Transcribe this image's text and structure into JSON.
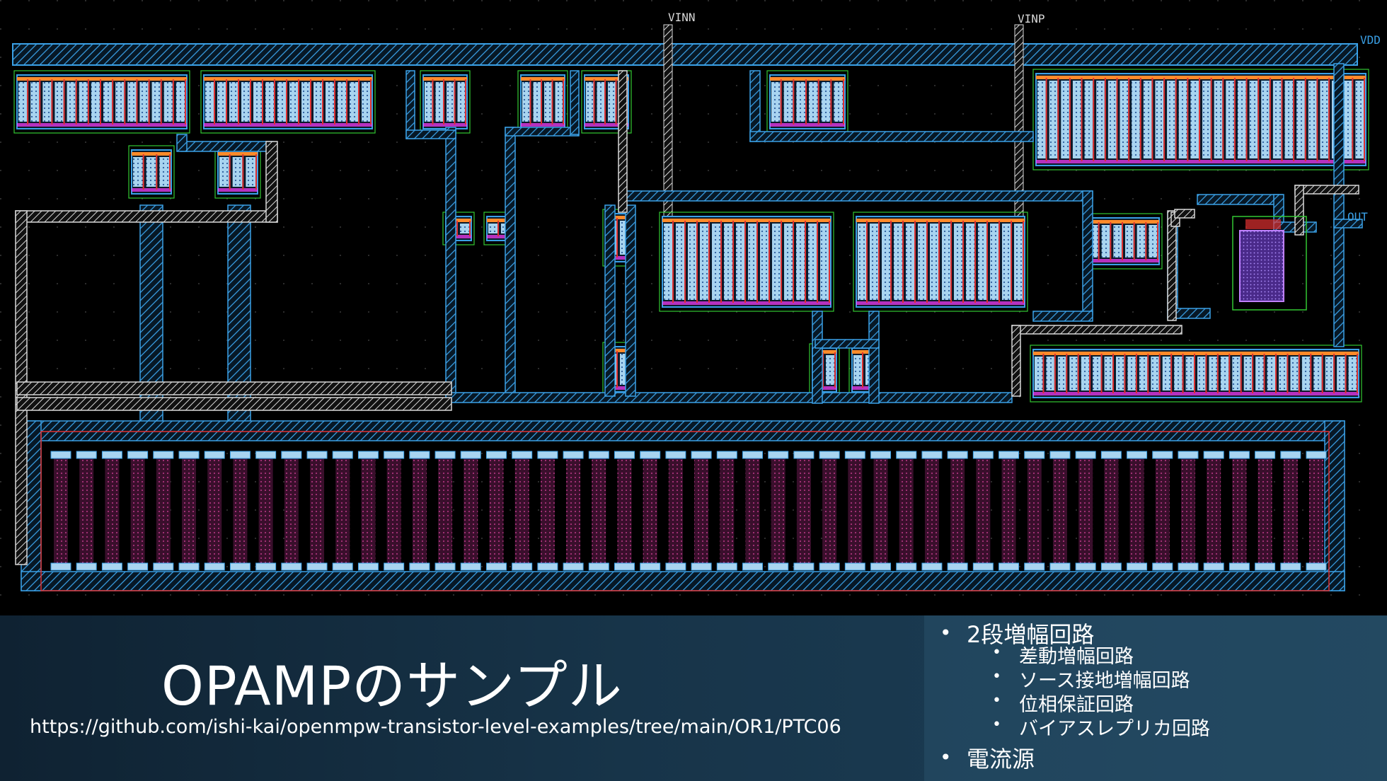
{
  "slide": {
    "title": "OPAMPのサンプル",
    "url": "https://github.com/ishi-kai/openmpw-transistor-level-examples/tree/main/OR1/PTC06"
  },
  "bullets": [
    {
      "text": "2段増幅回路",
      "children": [
        "差動増幅回路",
        "ソース接地増幅回路",
        "位相保証回路",
        "バイアスレプリカ回路"
      ]
    },
    {
      "text": "電流源",
      "children": []
    }
  ],
  "pins": {
    "vinn": "VINN",
    "vinp": "VINP",
    "vdd": "VDD",
    "out": "OUT"
  },
  "colors": {
    "background": "#000000",
    "metal1": "#3aa0e6",
    "metal2": "#d8d8d8",
    "poly": "#e03030",
    "diffusion": "#a8d4f0",
    "contact": "#ff3cff",
    "resistor": "#8a2a5a",
    "nwell": "#32c832"
  }
}
